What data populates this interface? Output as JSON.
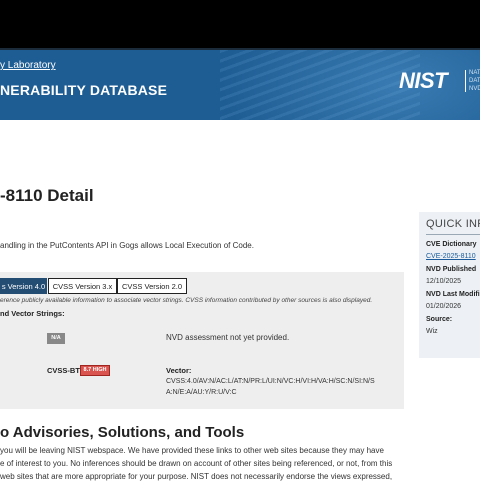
{
  "header": {
    "lab_link": "y Laboratory",
    "db_title": "NERABILITY DATABASE",
    "logo_text": "NIST",
    "logo_side_lines": [
      "NAT",
      "DAT",
      "NVD"
    ]
  },
  "main": {
    "title": "-8110 Detail",
    "description": "andling in the PutContents API in Gogs allows Local Execution of Code."
  },
  "metrics": {
    "tabs": [
      {
        "label": "s Version 4.0",
        "active": true
      },
      {
        "label": "CVSS Version 3.x",
        "active": false
      },
      {
        "label": "CVSS Version 2.0",
        "active": false
      }
    ],
    "note": "erence publicly available information to associate vector strings. CVSS information contributed by other sources is also displayed.",
    "vectors_title": "nd Vector Strings:",
    "na_badge": "N/A",
    "nvd_note": "NVD assessment not yet provided.",
    "cvss_bt_label": "CVSS-BT",
    "cvss_bt_badge": "8.7 HIGH",
    "vector_label": "Vector:",
    "vector_lines": [
      "CVSS:4.0/AV:N/AC:L/AT:N/PR:L/UI:N/VC:H/VI:H/VA:H/SC:N/SI:N/S",
      "A:N/E:A/AU:Y/R:U/V:C"
    ]
  },
  "references": {
    "title": "o Advisories, Solutions, and Tools",
    "lines": [
      "you will be leaving NIST webspace. We have provided these links to other web sites because they may have",
      "e of interest to you. No inferences should be drawn on account of other sites being referenced, or not, from this",
      "web sites that are more appropriate for your purpose. NIST does not necessarily endorse the views expressed,"
    ]
  },
  "quick_info": {
    "title": "QUICK INFO",
    "dictionary_label": "CVE Dictionary",
    "dictionary_value": "CVE-2025-8110",
    "published_label": "NVD Published",
    "published_value": "12/10/2025",
    "modified_label": "NVD Last Modifi",
    "modified_value": "01/20/2026",
    "source_label": "Source:",
    "source_value": "Wiz"
  },
  "colors": {
    "header_blue": "#1e5d94",
    "tab_active": "#244d74",
    "severity_high": "#d9534f",
    "badge_na": "#888888"
  }
}
